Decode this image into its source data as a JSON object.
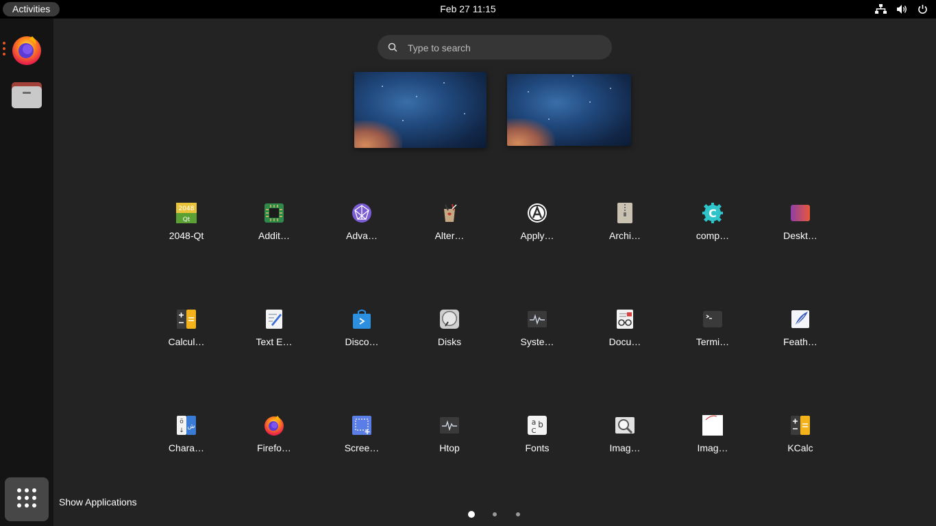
{
  "topbar": {
    "activities_label": "Activities",
    "clock": "Feb 27  11:15",
    "tray_icons": [
      "network-icon",
      "volume-icon",
      "power-icon"
    ]
  },
  "dock": {
    "apps": [
      {
        "name": "firefox",
        "icon": "firefox-icon"
      },
      {
        "name": "files",
        "icon": "files-icon"
      }
    ],
    "show_apps_tooltip": "Show Applications"
  },
  "search": {
    "placeholder": "Type to search",
    "value": ""
  },
  "app_grid": {
    "rows": [
      [
        {
          "label": "2048-Qt",
          "icon": "2048-icon"
        },
        {
          "label": "Addit…",
          "icon": "chip-icon"
        },
        {
          "label": "Adva…",
          "icon": "network-globe-icon"
        },
        {
          "label": "Alter…",
          "icon": "alternatives-icon"
        },
        {
          "label": "Apply…",
          "icon": "app-store-icon"
        },
        {
          "label": "Archi…",
          "icon": "archive-icon"
        },
        {
          "label": "comp…",
          "icon": "gear-c-icon"
        },
        {
          "label": "Deskt…",
          "icon": "desktop-gradient-icon"
        }
      ],
      [
        {
          "label": "Calcul…",
          "icon": "calculator-icon"
        },
        {
          "label": "Text E…",
          "icon": "text-editor-icon"
        },
        {
          "label": "Disco…",
          "icon": "software-bag-icon"
        },
        {
          "label": "Disks",
          "icon": "disks-icon"
        },
        {
          "label": "Syste…",
          "icon": "system-monitor-icon"
        },
        {
          "label": "Docu…",
          "icon": "document-viewer-icon"
        },
        {
          "label": "Termi…",
          "icon": "terminal-icon"
        },
        {
          "label": "Feath…",
          "icon": "feather-icon"
        }
      ],
      [
        {
          "label": "Chara…",
          "icon": "characters-icon"
        },
        {
          "label": "Firefo…",
          "icon": "firefox-icon"
        },
        {
          "label": "Scree…",
          "icon": "screenshot-icon"
        },
        {
          "label": "Htop",
          "icon": "htop-icon"
        },
        {
          "label": "Fonts",
          "icon": "fonts-icon"
        },
        {
          "label": "Imag…",
          "icon": "image-viewer-icon"
        },
        {
          "label": "Imag…",
          "icon": "image-blank-icon"
        },
        {
          "label": "KCalc",
          "icon": "kcalc-icon"
        }
      ]
    ]
  },
  "pagination": {
    "pages": 3,
    "current": 1
  },
  "colors": {
    "accent": "#e95420",
    "background": "#232323",
    "dock": "#141414",
    "topbar": "#000000"
  }
}
